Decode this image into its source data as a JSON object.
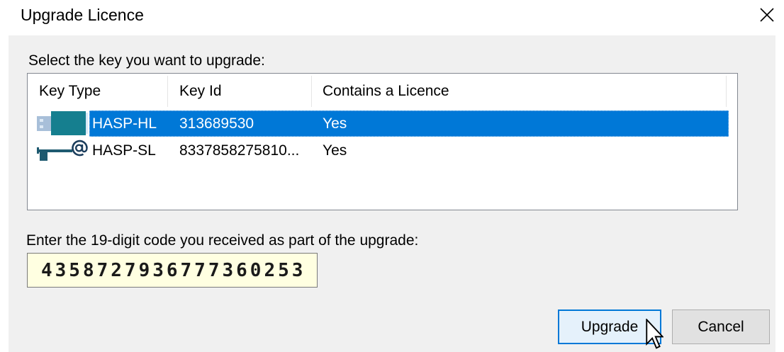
{
  "window": {
    "title": "Upgrade Licence",
    "close_icon": "close-icon"
  },
  "key_list": {
    "label": "Select the key you want to upgrade:",
    "columns": [
      "Key Type",
      "Key Id",
      "Contains a Licence"
    ],
    "rows": [
      {
        "icon": "usb-dongle-icon",
        "key_type": "HASP-HL",
        "key_id": "313689530",
        "contains_licence": "Yes",
        "selected": true
      },
      {
        "icon": "software-key-icon",
        "key_type": "HASP-SL",
        "key_id": "8337858275810...",
        "contains_licence": "Yes",
        "selected": false
      }
    ]
  },
  "upgrade_code": {
    "label": "Enter the 19-digit code you received as part of the upgrade:",
    "value": "4358727936777360253"
  },
  "buttons": {
    "upgrade": "Upgrade",
    "cancel": "Cancel"
  },
  "cursor_icon": "mouse-pointer-icon",
  "colors": {
    "selection": "#0078d7",
    "default_button_border": "#0078d7",
    "default_button_background": "#e5f1fb",
    "input_background": "#ffffe1",
    "dialog_background": "#f0f0f0"
  }
}
